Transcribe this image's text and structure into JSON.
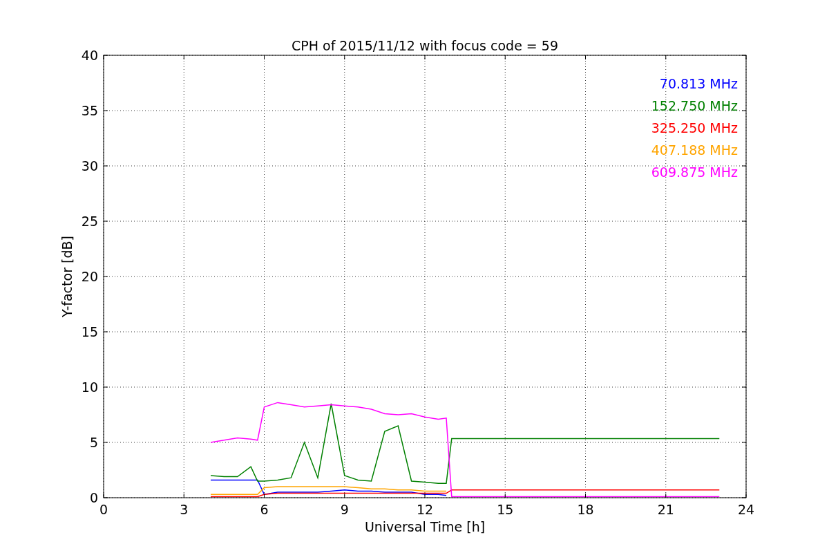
{
  "chart_data": {
    "type": "line",
    "title": "CPH of 2015/11/12 with focus code = 59",
    "xlabel": "Universal Time [h]",
    "ylabel": "Y-factor [dB]",
    "x": [
      4,
      4.5,
      5,
      5.5,
      5.75,
      6,
      6.5,
      7,
      7.5,
      8,
      8.5,
      9,
      9.5,
      10,
      10.5,
      11,
      11.5,
      12,
      12.5,
      12.8,
      13,
      14,
      15,
      16,
      17,
      18,
      19,
      20,
      21,
      22,
      23
    ],
    "series": [
      {
        "name": "70.813 MHz",
        "color": "#0000ff",
        "values": [
          1.6,
          1.6,
          1.6,
          1.6,
          1.6,
          0.3,
          0.5,
          0.5,
          0.5,
          0.5,
          0.6,
          0.7,
          0.6,
          0.6,
          0.5,
          0.5,
          0.5,
          0.3,
          0.3,
          0.2,
          null,
          null,
          null,
          null,
          null,
          null,
          null,
          null,
          null,
          null,
          null
        ]
      },
      {
        "name": "152.750 MHz",
        "color": "#008000",
        "values": [
          2.0,
          1.9,
          1.9,
          2.8,
          1.5,
          1.5,
          1.6,
          1.8,
          5.0,
          1.8,
          8.5,
          2.0,
          1.6,
          1.5,
          6.0,
          6.5,
          1.5,
          1.4,
          1.3,
          1.3,
          5.35,
          5.35,
          5.35,
          5.35,
          5.35,
          5.35,
          5.35,
          5.35,
          5.35,
          5.35,
          5.35
        ]
      },
      {
        "name": "325.250 MHz",
        "color": "#ff0000",
        "values": [
          0.1,
          0.1,
          0.1,
          0.1,
          0.1,
          0.3,
          0.4,
          0.4,
          0.4,
          0.4,
          0.4,
          0.4,
          0.4,
          0.4,
          0.4,
          0.4,
          0.4,
          0.4,
          0.4,
          0.4,
          0.7,
          0.7,
          0.7,
          0.7,
          0.7,
          0.7,
          0.7,
          0.7,
          0.7,
          0.7,
          0.7
        ]
      },
      {
        "name": "407.188 MHz",
        "color": "#ffa500",
        "values": [
          0.3,
          0.3,
          0.3,
          0.3,
          0.3,
          0.9,
          1.0,
          1.0,
          1.0,
          1.0,
          1.0,
          1.0,
          0.9,
          0.8,
          0.8,
          0.7,
          0.7,
          0.6,
          0.6,
          0.6,
          null,
          null,
          null,
          null,
          null,
          null,
          null,
          null,
          null,
          null,
          null
        ]
      },
      {
        "name": "609.875 MHz",
        "color": "#ff00ff",
        "values": [
          5.0,
          5.2,
          5.4,
          5.3,
          5.2,
          8.2,
          8.6,
          8.4,
          8.2,
          8.3,
          8.4,
          8.3,
          8.2,
          8.0,
          7.6,
          7.5,
          7.6,
          7.3,
          7.1,
          7.2,
          0.1,
          0.1,
          0.1,
          0.1,
          0.1,
          0.1,
          0.1,
          0.1,
          0.1,
          0.1,
          0.1
        ]
      }
    ],
    "xlim": [
      0,
      24
    ],
    "ylim": [
      0,
      40
    ],
    "xticks": [
      0,
      3,
      6,
      9,
      12,
      15,
      18,
      21,
      24
    ],
    "yticks": [
      0,
      5,
      10,
      15,
      20,
      25,
      30,
      35,
      40
    ],
    "grid": true
  }
}
